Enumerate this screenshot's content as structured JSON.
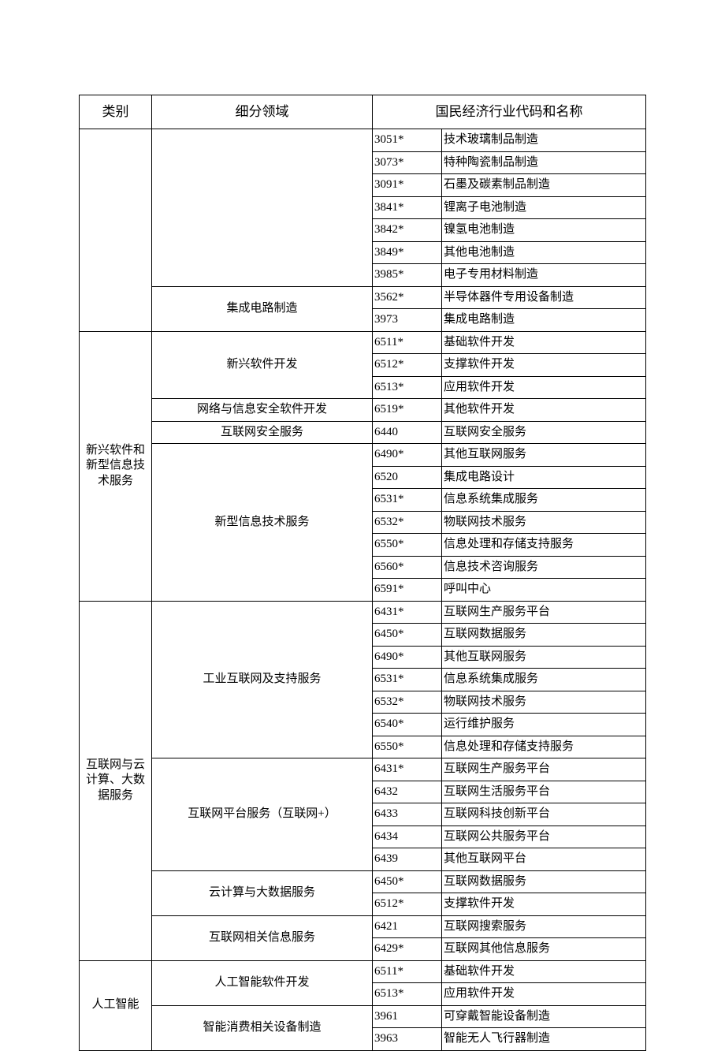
{
  "headers": {
    "category": "类别",
    "subdomain": "细分领域",
    "code_name": "国民经济行业代码和名称"
  },
  "rows": [
    {
      "category": "",
      "catRows": 9,
      "subdomain": "",
      "subRows": 7,
      "code": "3051*",
      "name": "技术玻璃制品制造"
    },
    {
      "code": "3073*",
      "name": "特种陶瓷制品制造"
    },
    {
      "code": "3091*",
      "name": "石墨及碳素制品制造"
    },
    {
      "code": "3841*",
      "name": "锂离子电池制造"
    },
    {
      "code": "3842*",
      "name": "镍氢电池制造"
    },
    {
      "code": "3849*",
      "name": "其他电池制造"
    },
    {
      "code": "3985*",
      "name": "电子专用材料制造"
    },
    {
      "subdomain": "集成电路制造",
      "subRows": 2,
      "code": "3562*",
      "name": "半导体器件专用设备制造"
    },
    {
      "code": "3973",
      "name": "集成电路制造"
    },
    {
      "category": "新兴软件和新型信息技术服务",
      "catRows": 12,
      "subdomain": "新兴软件开发",
      "subRows": 3,
      "code": "6511*",
      "name": "基础软件开发"
    },
    {
      "code": "6512*",
      "name": "支撑软件开发"
    },
    {
      "code": "6513*",
      "name": "应用软件开发"
    },
    {
      "subdomain": "网络与信息安全软件开发",
      "subRows": 1,
      "code": "6519*",
      "name": "其他软件开发"
    },
    {
      "subdomain": "互联网安全服务",
      "subRows": 1,
      "code": "6440",
      "name": "互联网安全服务"
    },
    {
      "subdomain": "新型信息技术服务",
      "subRows": 7,
      "code": "6490*",
      "name": "其他互联网服务"
    },
    {
      "code": "6520",
      "name": "集成电路设计"
    },
    {
      "code": "6531*",
      "name": "信息系统集成服务"
    },
    {
      "code": "6532*",
      "name": "物联网技术服务"
    },
    {
      "code": "6550*",
      "name": "信息处理和存储支持服务"
    },
    {
      "code": "6560*",
      "name": "信息技术咨询服务"
    },
    {
      "code": "6591*",
      "name": "呼叫中心"
    },
    {
      "category": "互联网与云计算、大数据服务",
      "catRows": 16,
      "subdomain": "工业互联网及支持服务",
      "subRows": 7,
      "code": "6431*",
      "name": "互联网生产服务平台"
    },
    {
      "code": "6450*",
      "name": "互联网数据服务"
    },
    {
      "code": "6490*",
      "name": "其他互联网服务"
    },
    {
      "code": "6531*",
      "name": "信息系统集成服务"
    },
    {
      "code": "6532*",
      "name": "物联网技术服务"
    },
    {
      "code": "6540*",
      "name": "运行维护服务"
    },
    {
      "code": "6550*",
      "name": "信息处理和存储支持服务"
    },
    {
      "subdomain": "互联网平台服务（互联网+）",
      "subRows": 5,
      "code": "6431*",
      "name": "互联网生产服务平台"
    },
    {
      "code": "6432",
      "name": "互联网生活服务平台"
    },
    {
      "code": "6433",
      "name": "互联网科技创新平台"
    },
    {
      "code": "6434",
      "name": "互联网公共服务平台"
    },
    {
      "code": "6439",
      "name": "其他互联网平台"
    },
    {
      "subdomain": "云计算与大数据服务",
      "subRows": 2,
      "code": "6450*",
      "name": "互联网数据服务"
    },
    {
      "code": "6512*",
      "name": "支撑软件开发"
    },
    {
      "subdomain": "互联网相关信息服务",
      "subRows": 2,
      "code": "6421",
      "name": "互联网搜索服务"
    },
    {
      "code": "6429*",
      "name": "互联网其他信息服务"
    },
    {
      "category": "人工智能",
      "catRows": 4,
      "subdomain": "人工智能软件开发",
      "subRows": 2,
      "code": "6511*",
      "name": "基础软件开发"
    },
    {
      "code": "6513*",
      "name": "应用软件开发"
    },
    {
      "subdomain": "智能消费相关设备制造",
      "subRows": 2,
      "code": "3961",
      "name": "可穿戴智能设备制造"
    },
    {
      "code": "3963",
      "name": "智能无人飞行器制造"
    }
  ]
}
